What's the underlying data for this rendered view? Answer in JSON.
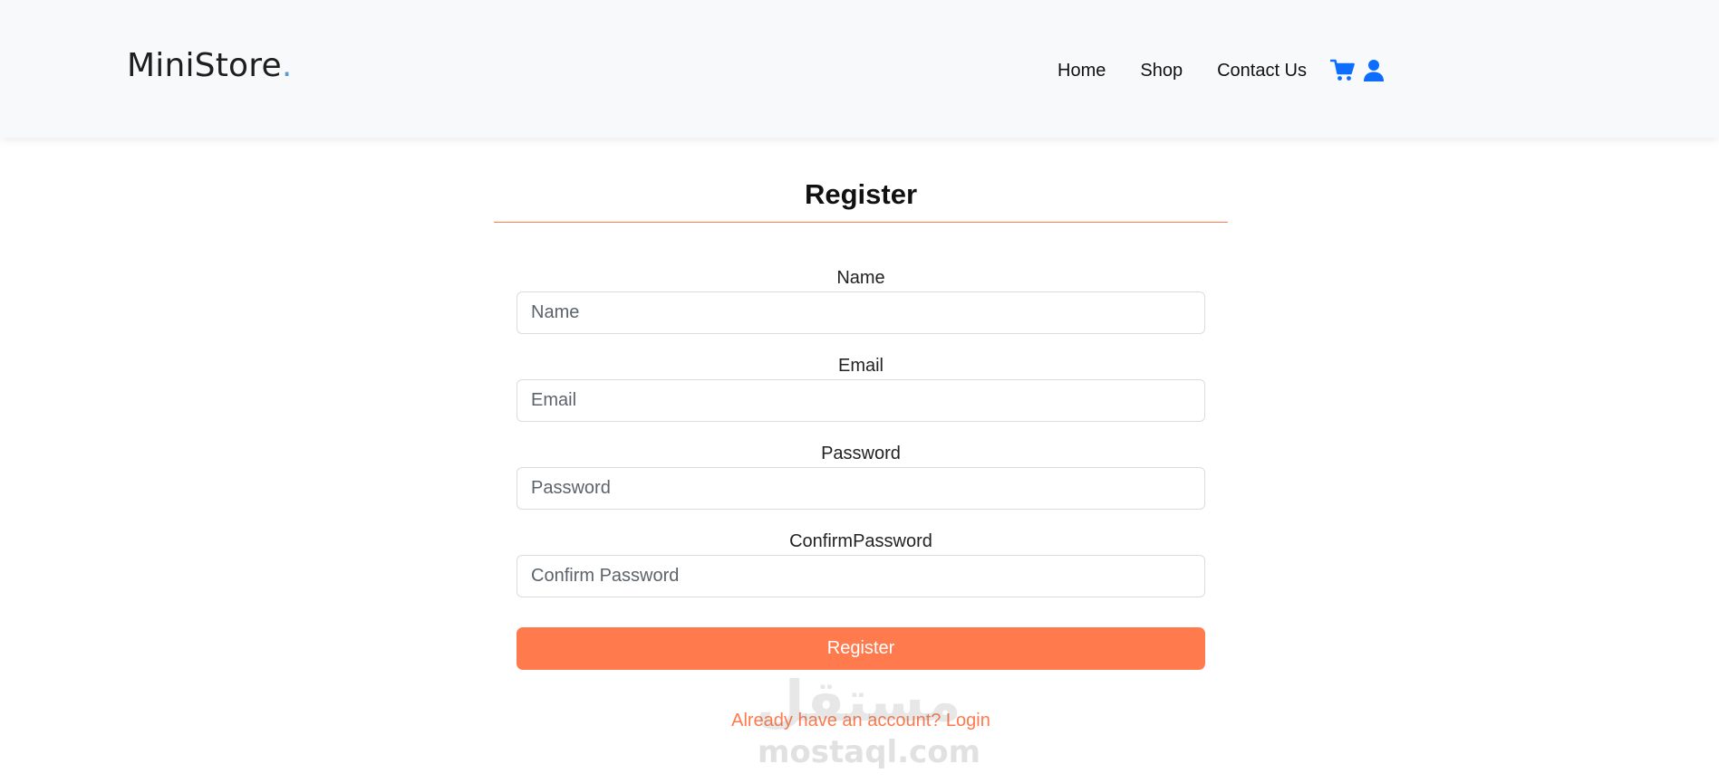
{
  "brand": {
    "name": "MiniStore",
    "dot": ".",
    "dot_color": "#5b9bd8"
  },
  "nav": {
    "links": [
      "Home",
      "Shop",
      "Contact Us"
    ],
    "icons": [
      "cart-icon",
      "user-icon"
    ],
    "icon_color": "#0d6efd"
  },
  "form": {
    "title": "Register",
    "accent_color": "#ff7a4d",
    "fields": [
      {
        "label": "Name",
        "placeholder": "Name",
        "value": ""
      },
      {
        "label": "Email",
        "placeholder": "Email",
        "value": ""
      },
      {
        "label": "Password",
        "placeholder": "Password",
        "value": ""
      },
      {
        "label": "ConfirmPassword",
        "placeholder": "Confirm Password",
        "value": ""
      }
    ],
    "submit_label": "Register",
    "login_link": "Already have an account? Login"
  },
  "watermark": {
    "arabic": "مستقل",
    "latin": "mostaql.com"
  }
}
